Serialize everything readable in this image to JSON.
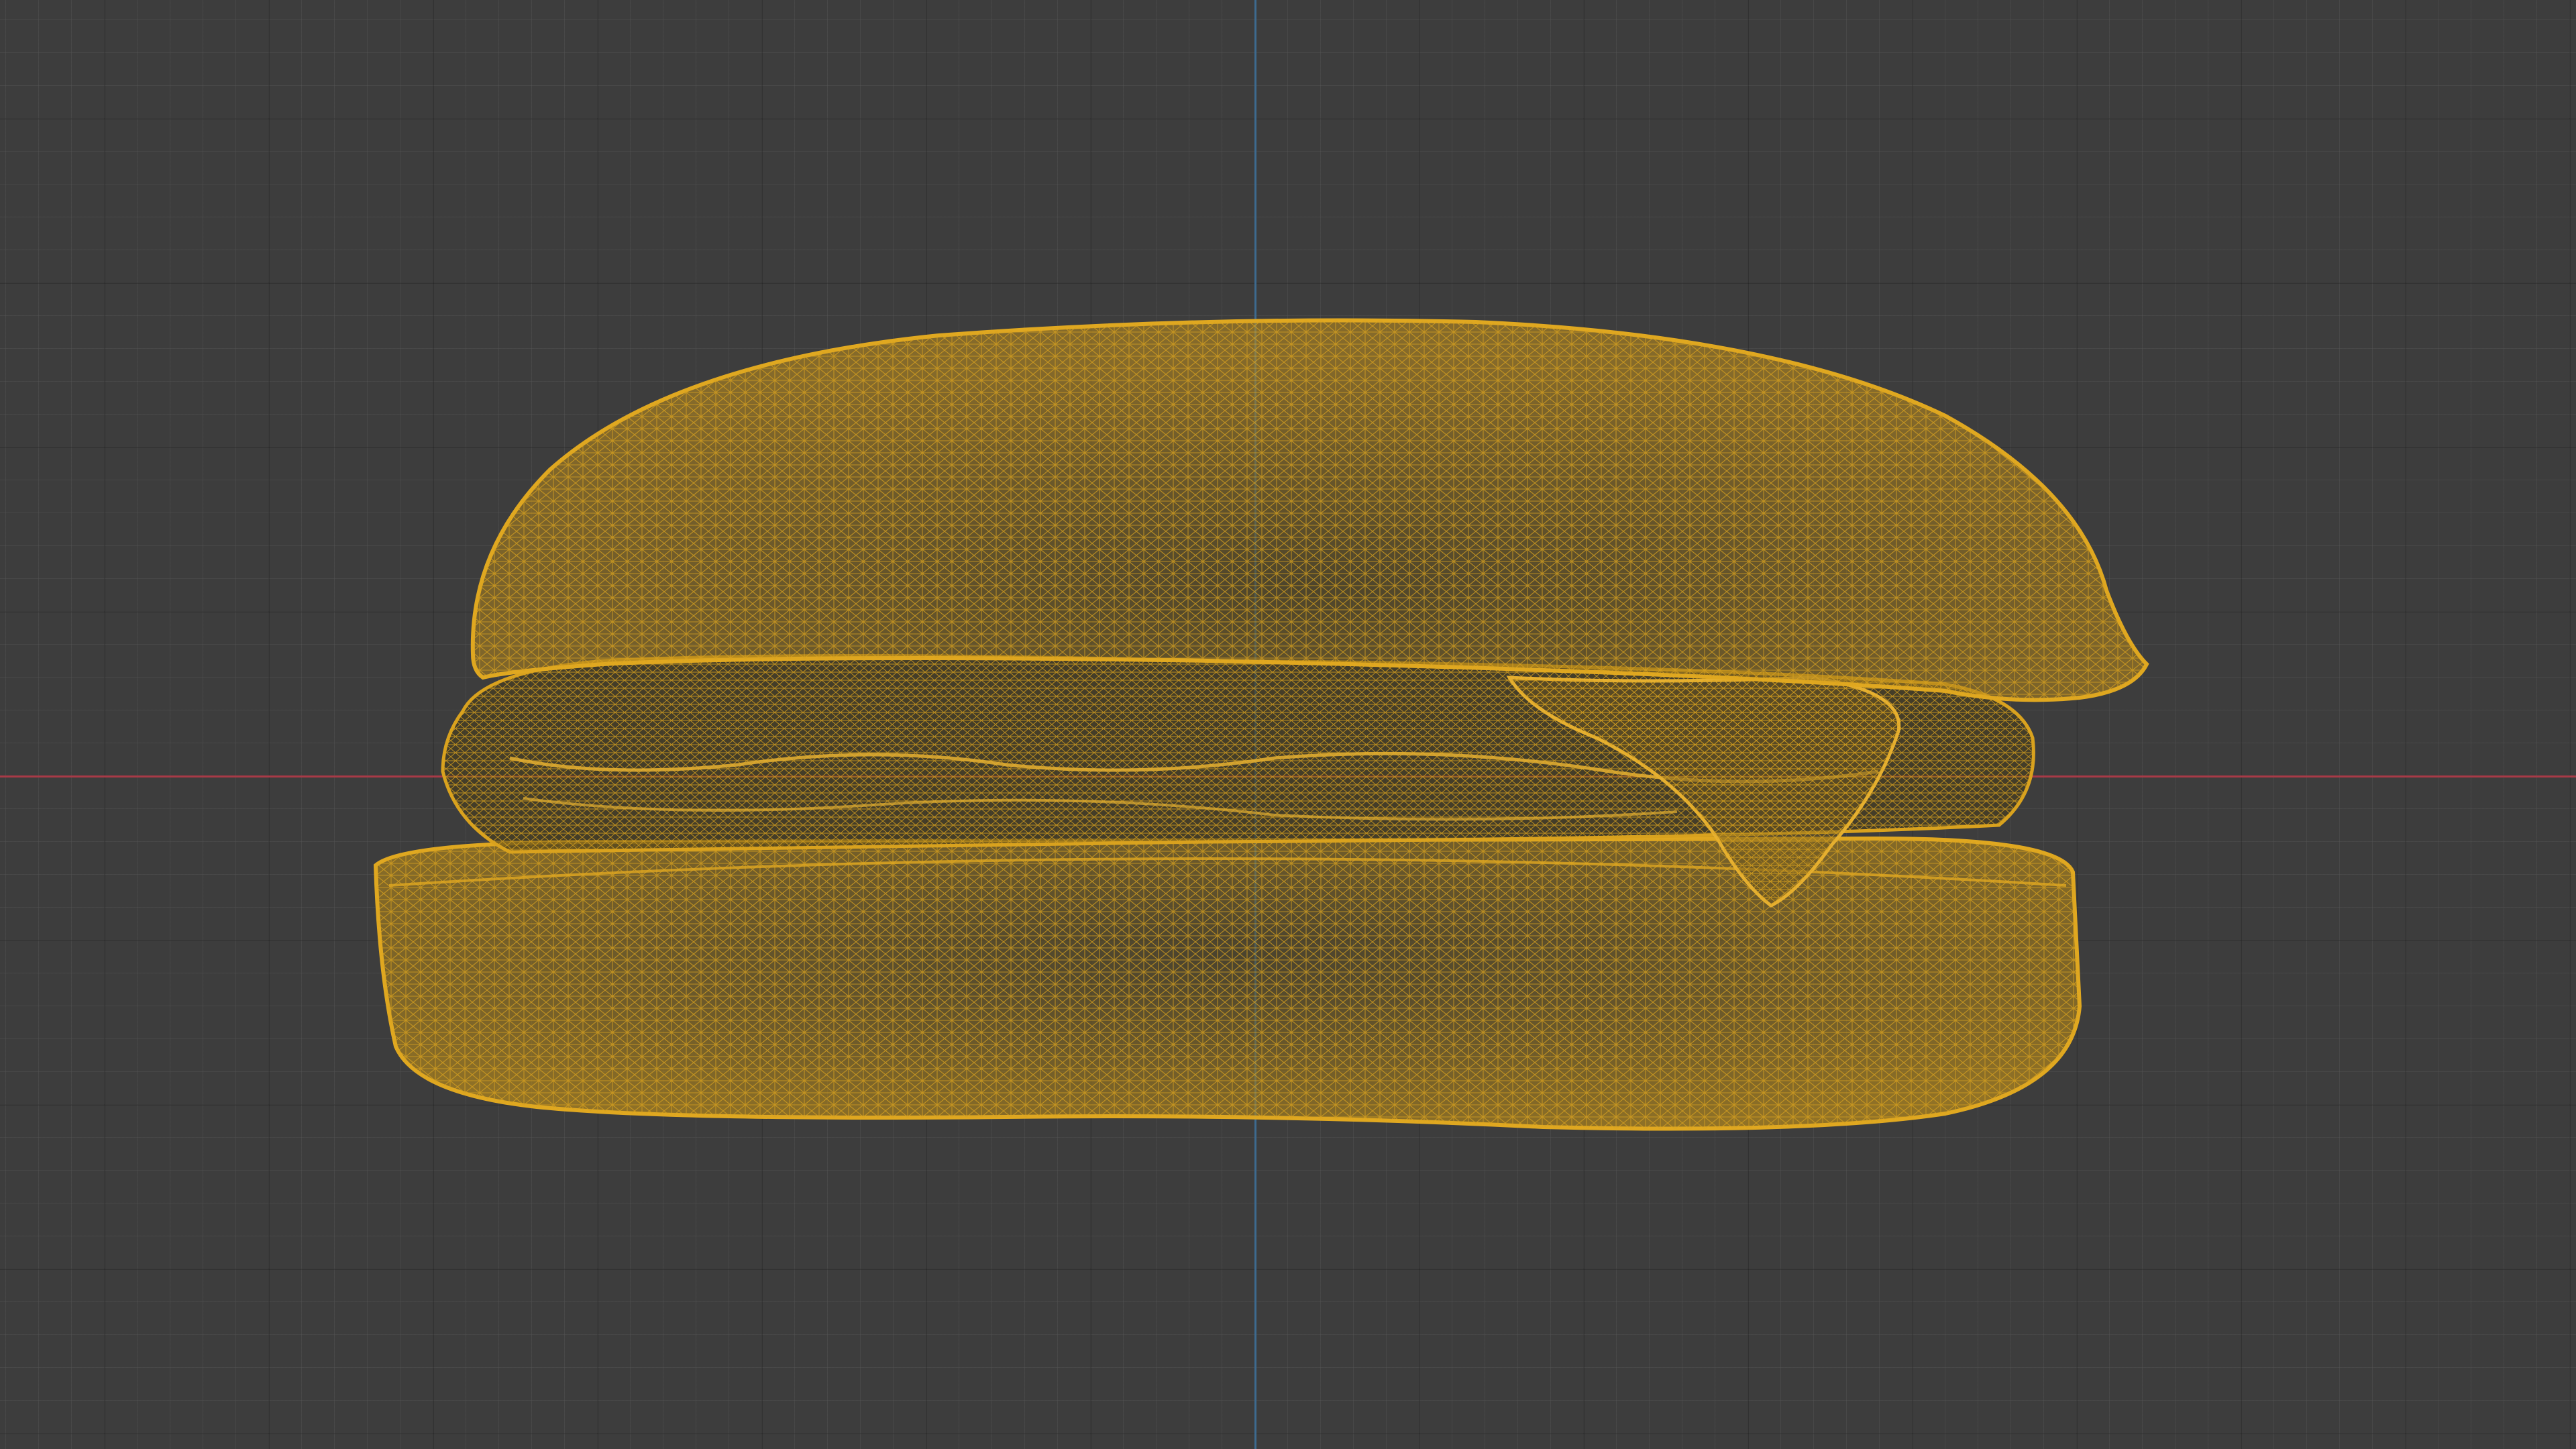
{
  "viewport": {
    "background_color": "#3d3d3d",
    "grid_minor_color": "#4a4a4a",
    "grid_major_color": "#353535"
  },
  "axes": {
    "x_axis_color": "#a83a47",
    "y_axis_color": "#3d6a8f"
  },
  "object": {
    "name": "hamburger-mesh",
    "display_mode": "wireframe",
    "wire_color": "#d9a21e",
    "parts": [
      "top-bun",
      "patty",
      "cheese-slice",
      "bottom-bun"
    ]
  }
}
